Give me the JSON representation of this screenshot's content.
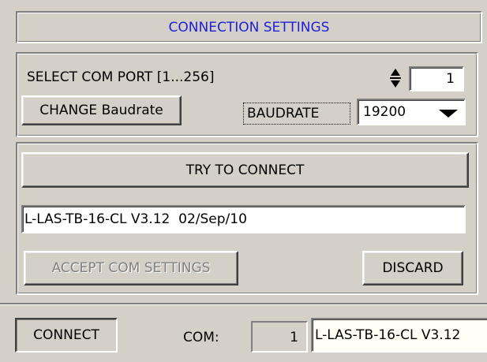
{
  "header": {
    "title": "CONNECTION SETTINGS"
  },
  "com_port": {
    "label": "SELECT COM PORT [1...256]",
    "value": "1"
  },
  "baud": {
    "change_button": "CHANGE Baudrate",
    "label": "BAUDRATE",
    "selected": "19200"
  },
  "connect_section": {
    "try_button": "TRY TO CONNECT",
    "result_text": "L-LAS-TB-16-CL V3.12  02/Sep/10",
    "accept_button": "ACCEPT COM SETTINGS",
    "discard_button": "DISCARD"
  },
  "status_bar": {
    "connect_button": "CONNECT",
    "com_label": "COM:",
    "com_value": "1",
    "device_text": "L-LAS-TB-16-CL V3.12"
  },
  "icons": [
    "spinner-arrows-icon",
    "dropdown-arrow-icon"
  ]
}
